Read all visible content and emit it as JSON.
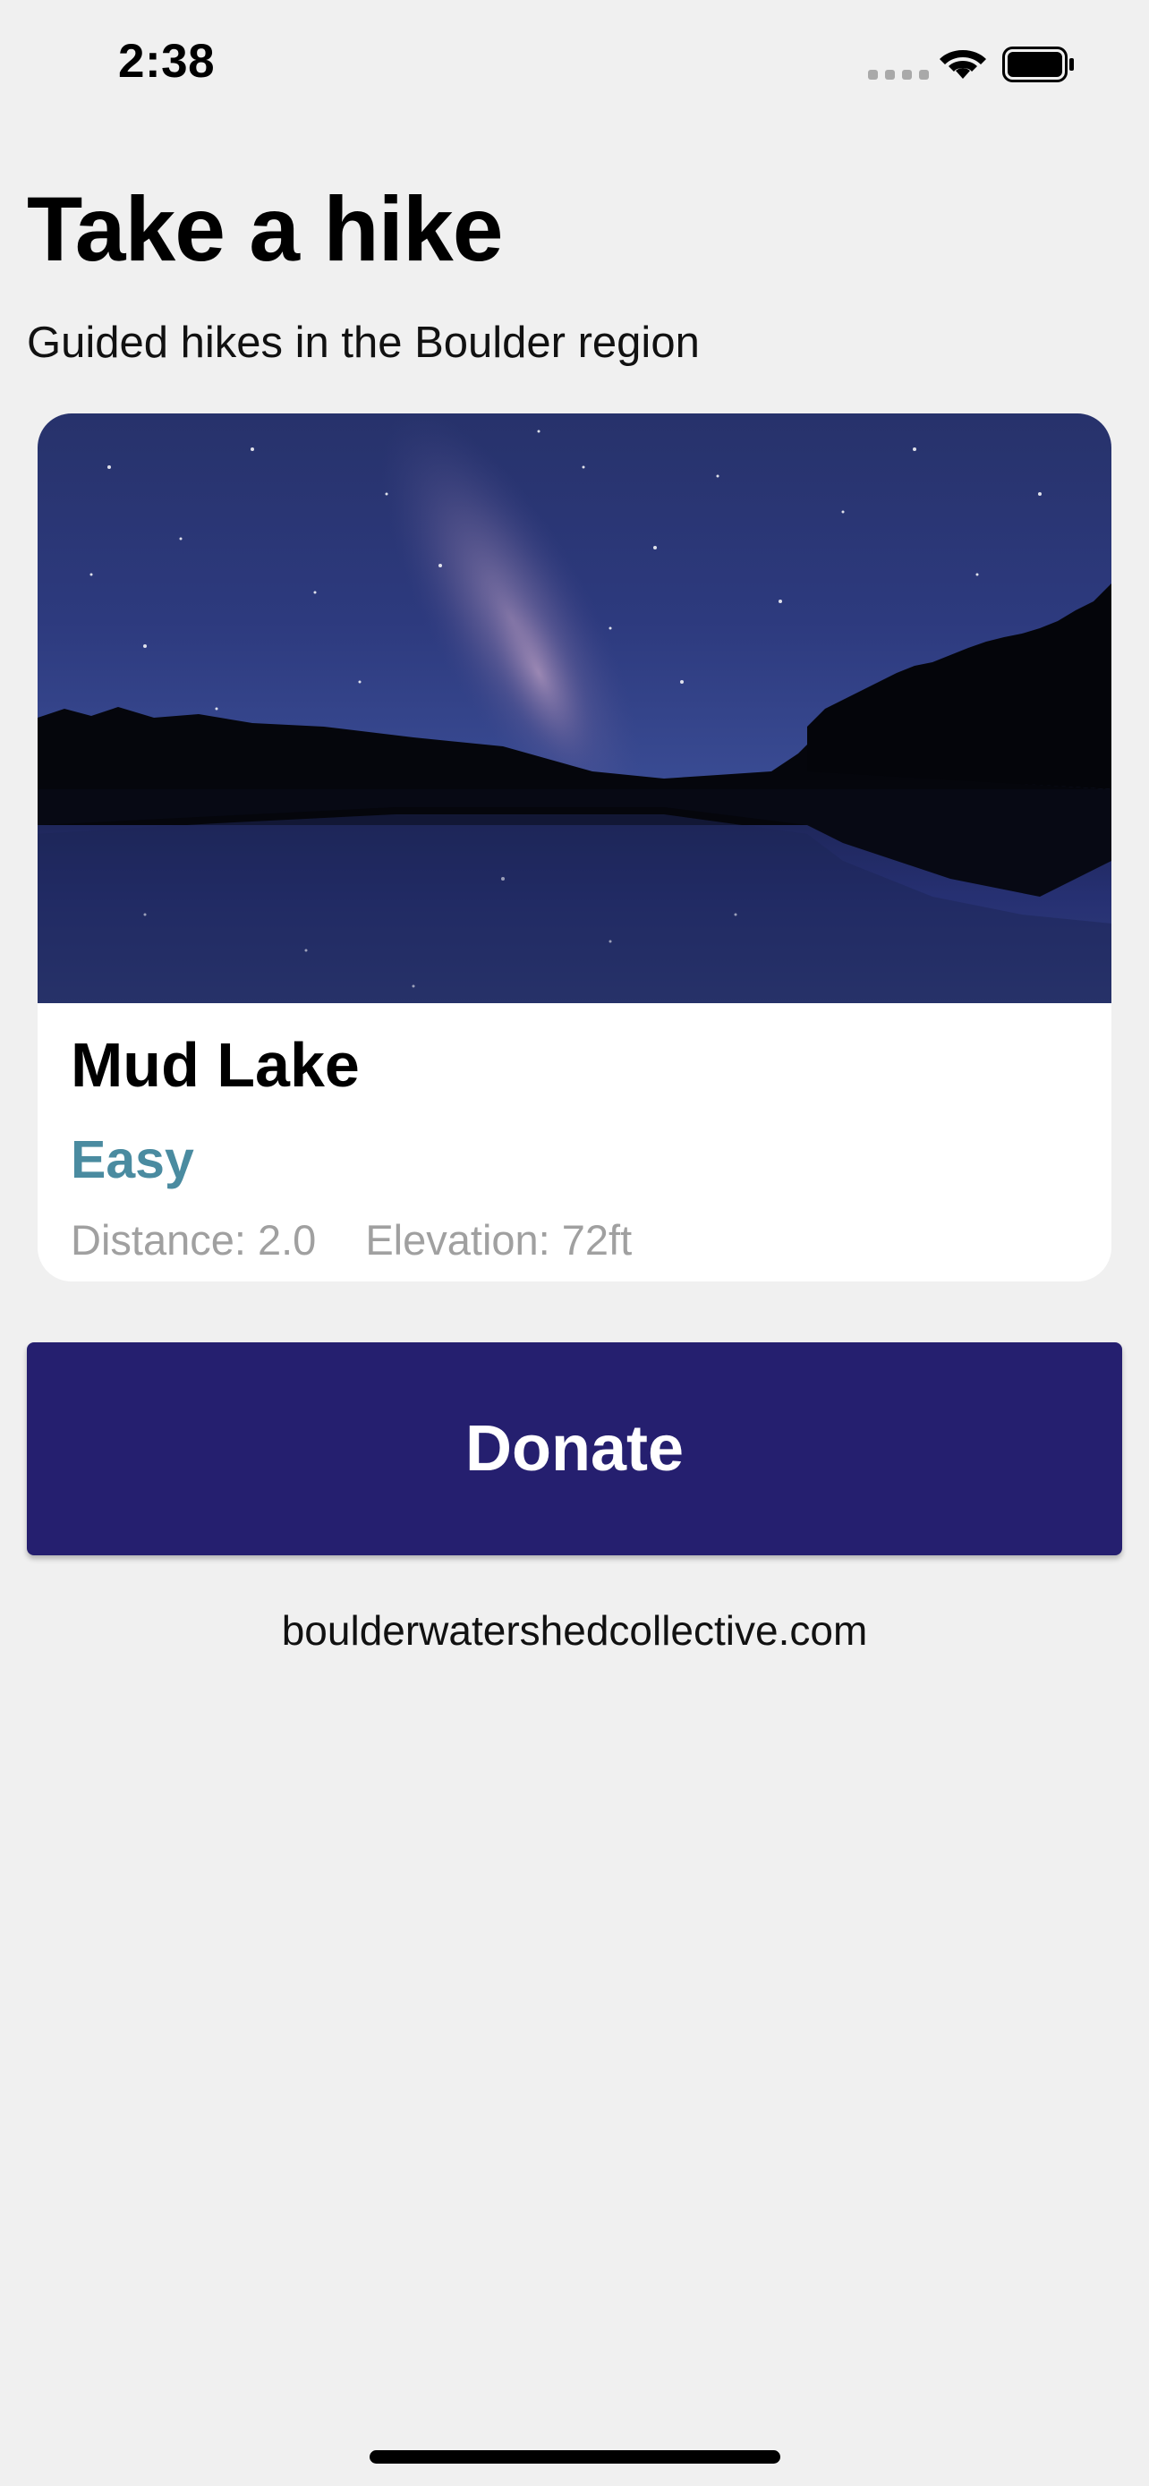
{
  "status_bar": {
    "time": "2:38"
  },
  "header": {
    "title": "Take a hike",
    "subtitle": "Guided hikes in the Boulder region"
  },
  "hike_card": {
    "title": "Mud Lake",
    "difficulty": "Easy",
    "distance": "Distance: 2.0",
    "elevation": "Elevation: 72ft"
  },
  "donate": {
    "label": "Donate"
  },
  "footer": {
    "website": "boulderwatershedcollective.com"
  },
  "colors": {
    "background": "#f0f0f0",
    "donate_button": "#251f6f",
    "difficulty_text": "#4a8ba0",
    "stats_text": "#a0a0a0"
  }
}
